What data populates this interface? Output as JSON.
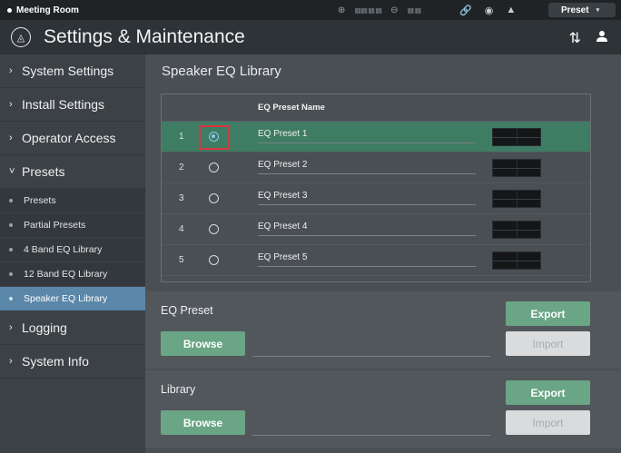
{
  "status_bar": {
    "room_name": "Meeting Room",
    "preset_label": "Preset",
    "preset_chevron": "▾",
    "icons": [
      "input-meter-icon",
      "output-meter-icon",
      "link-icon",
      "record-icon",
      "warning-icon"
    ]
  },
  "title_bar": {
    "logo_glyph": "◬",
    "title": "Settings & Maintenance",
    "mixer_icon": "⇅",
    "user_icon": "👤"
  },
  "sidebar": {
    "items": [
      {
        "label": "System Settings",
        "caret": "›"
      },
      {
        "label": "Install Settings",
        "caret": "›"
      },
      {
        "label": "Operator Access",
        "caret": "›"
      },
      {
        "label": "Presets",
        "caret": "˅"
      }
    ],
    "sub_items": [
      {
        "label": "Presets"
      },
      {
        "label": "Partial Presets"
      },
      {
        "label": "4 Band EQ Library"
      },
      {
        "label": "12 Band EQ Library"
      },
      {
        "label": "Speaker EQ Library"
      }
    ],
    "items_after": [
      {
        "label": "Logging",
        "caret": "›"
      },
      {
        "label": "System Info",
        "caret": "›"
      }
    ]
  },
  "main": {
    "section_title": "Speaker EQ Library",
    "table": {
      "header_name": "EQ Preset Name",
      "rows": [
        {
          "num": "1",
          "name": "EQ Preset 1",
          "selected": true
        },
        {
          "num": "2",
          "name": "EQ Preset 2",
          "selected": false
        },
        {
          "num": "3",
          "name": "EQ Preset 3",
          "selected": false
        },
        {
          "num": "4",
          "name": "EQ Preset 4",
          "selected": false
        },
        {
          "num": "5",
          "name": "EQ Preset 5",
          "selected": false
        }
      ]
    },
    "eq_preset_panel": {
      "label": "EQ Preset",
      "export_label": "Export",
      "browse_label": "Browse",
      "import_label": "Import"
    },
    "library_panel": {
      "label": "Library",
      "export_label": "Export",
      "browse_label": "Browse",
      "import_label": "Import"
    }
  },
  "colors": {
    "accent_green": "#6aa585",
    "selected_row": "#3f7c64",
    "active_nav": "#5b87a9",
    "focus_outline": "#d9343f"
  }
}
